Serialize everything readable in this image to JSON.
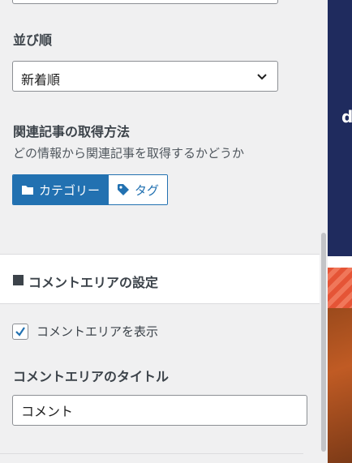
{
  "sort": {
    "label": "並び順",
    "selected": "新着順"
  },
  "related": {
    "label": "関連記事の取得方法",
    "description": "どの情報から関連記事を取得するかどうか",
    "options": [
      {
        "label": "カテゴリー",
        "active": true,
        "icon": "folder-icon"
      },
      {
        "label": "タグ",
        "active": false,
        "icon": "tag-icon"
      }
    ]
  },
  "comment_section": {
    "title": "コメントエリアの設定",
    "show_label": "コメントエリアを表示",
    "show_checked": true,
    "title_label": "コメントエリアのタイトル",
    "title_value": "コメント"
  },
  "preview": {
    "logo_letter": "d"
  },
  "colors": {
    "accent": "#2271b1",
    "navy": "#1f2b5e"
  }
}
